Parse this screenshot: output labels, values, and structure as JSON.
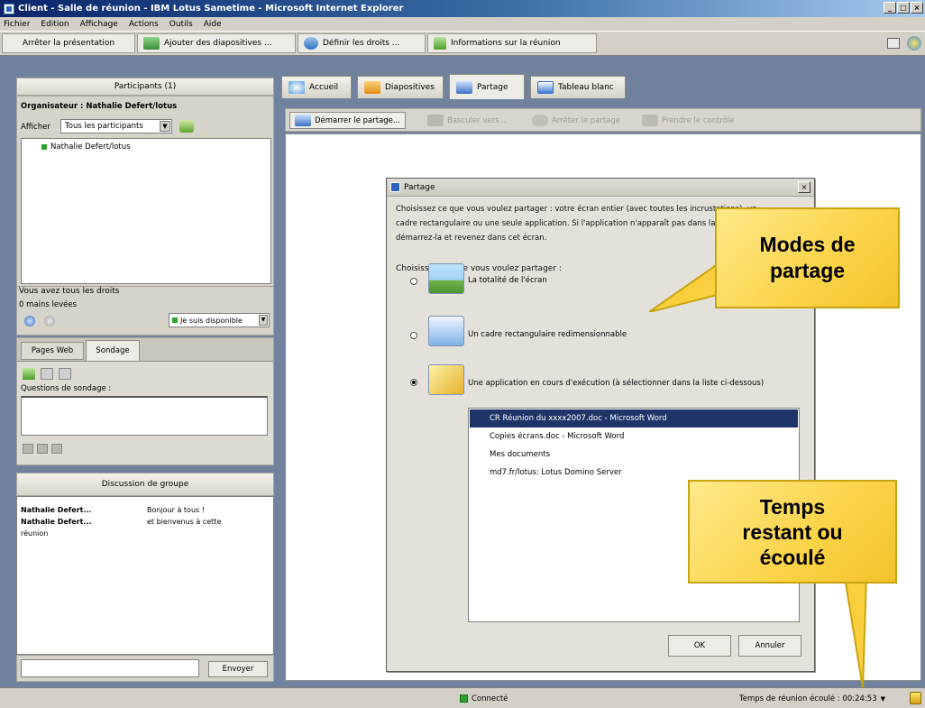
{
  "window": {
    "title": "Client - Salle de réunion - IBM Lotus Sametime - Microsoft Internet Explorer",
    "controls": [
      "_",
      "□",
      "×"
    ]
  },
  "menu": [
    "Fichier",
    "Edition",
    "Affichage",
    "Actions",
    "Outils",
    "Aide"
  ],
  "toolbar": {
    "stop_presentation": "Arrêter la présentation",
    "add_slides": "Ajouter des diapositives ...",
    "set_rights": "Définir les droits ...",
    "meeting_info": "Informations sur la réunion"
  },
  "participants": {
    "header": "Participants (1)",
    "organizer": "Organisateur : Nathalie Defert/lotus",
    "show_label": "Afficher",
    "filter_value": "Tous les participants",
    "list": [
      "Nathalie Defert/lotus"
    ],
    "rights_text": "Vous avez tous les droits",
    "hands_text": "0 mains levées",
    "status_value": "Je suis disponible"
  },
  "lower_tabs": {
    "web_pages": "Pages Web",
    "poll": "Sondage",
    "poll_questions_label": "Questions de sondage :"
  },
  "chat": {
    "header": "Discussion de groupe",
    "messages": [
      {
        "author": "Nathalie Defert...",
        "text": "Bonjour à tous !"
      },
      {
        "author": "Nathalie Defert...",
        "text": "et bienvenus à cette"
      }
    ],
    "continuation": "réunion",
    "send_label": "Envoyer"
  },
  "main_tabs": [
    "Accueil",
    "Diapositives",
    "Partage",
    "Tableau blanc"
  ],
  "sharing_toolbar": {
    "start": "Démarrer le partage...",
    "switch": "Basculer vers...",
    "stop": "Arrêter le partage",
    "take_control": "Prendre le contrôle"
  },
  "dialog": {
    "title": "Partage",
    "close": "×",
    "intro_lines": [
      "Choisissez ce que vous voulez partager : votre écran entier (avec toutes les incrustations), un",
      "cadre rectangulaire ou une seule application.  Si l'application n'apparaît pas dans la liste,",
      "démarrez-la et revenez dans cet écran."
    ],
    "prompt": "Choisissez ce que vous voulez partager :",
    "options": [
      "La totalité de l'écran",
      "Un cadre rectangulaire redimensionnable",
      "Une application en cours d'exécution (à sélectionner dans la liste ci-dessous)"
    ],
    "applications": [
      "CR Réunion du xxxx2007.doc - Microsoft Word",
      "Copies écrans.doc - Microsoft Word",
      "Mes documents",
      "md7.fr/lotus: Lotus Domino Server"
    ],
    "ok": "OK",
    "cancel": "Annuler"
  },
  "callouts": {
    "modes": [
      "Modes de",
      "partage"
    ],
    "time": [
      "Temps",
      "restant ou",
      "écoulé"
    ]
  },
  "statusbar": {
    "connected": "Connecté",
    "elapsed": "Temps de réunion écoulé : 00:24:53"
  }
}
